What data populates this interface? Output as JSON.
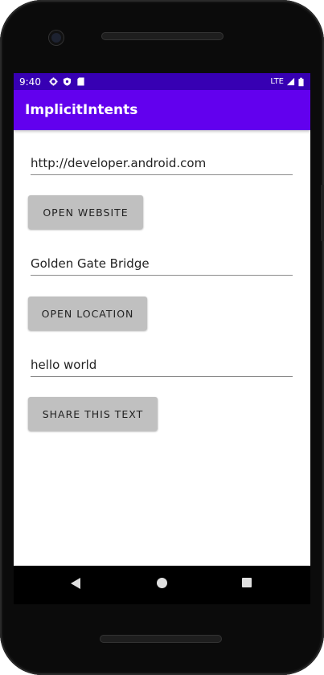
{
  "status_bar": {
    "time": "9:40",
    "network": "LTE",
    "icons": [
      "settings-icon",
      "shield-icon",
      "sd-card-icon",
      "signal-icon",
      "battery-icon"
    ]
  },
  "app_bar": {
    "title": "ImplicitIntents"
  },
  "form": {
    "website_input": {
      "value": "http://developer.android.com"
    },
    "open_website_button": {
      "label": "OPEN WEBSITE"
    },
    "location_input": {
      "value": "Golden Gate Bridge"
    },
    "open_location_button": {
      "label": "OPEN LOCATION"
    },
    "share_input": {
      "value": "hello world"
    },
    "share_text_button": {
      "label": "SHARE THIS TEXT"
    }
  },
  "nav_bar": {
    "icons": [
      "back-icon",
      "home-icon",
      "recents-icon"
    ]
  },
  "colors": {
    "status_bar": "#3700b3",
    "app_bar": "#6200ee",
    "button": "#c0c0c0"
  }
}
